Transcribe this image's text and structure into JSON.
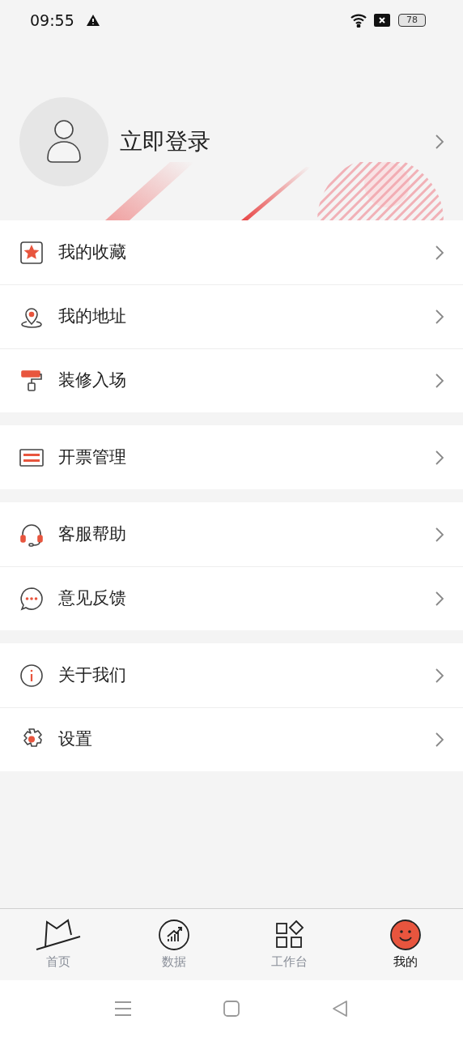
{
  "status_bar": {
    "time": "09:55",
    "battery": "78"
  },
  "profile": {
    "login_label": "立即登录"
  },
  "menu_groups": [
    {
      "items": [
        {
          "kind": "star",
          "label": "我的收藏"
        },
        {
          "kind": "pin",
          "label": "我的地址"
        },
        {
          "kind": "roller",
          "label": "装修入场"
        }
      ]
    },
    {
      "items": [
        {
          "kind": "invoice",
          "label": "开票管理"
        }
      ]
    },
    {
      "items": [
        {
          "kind": "headset",
          "label": "客服帮助"
        },
        {
          "kind": "chat",
          "label": "意见反馈"
        }
      ]
    },
    {
      "items": [
        {
          "kind": "info",
          "label": "关于我们"
        },
        {
          "kind": "gear",
          "label": "设置"
        }
      ]
    }
  ],
  "tab_bar": [
    {
      "kind": "home",
      "label": "首页",
      "selected": false
    },
    {
      "kind": "data",
      "label": "数据",
      "selected": false
    },
    {
      "kind": "workbench",
      "label": "工作台",
      "selected": false
    },
    {
      "kind": "me",
      "label": "我的",
      "selected": true
    }
  ]
}
